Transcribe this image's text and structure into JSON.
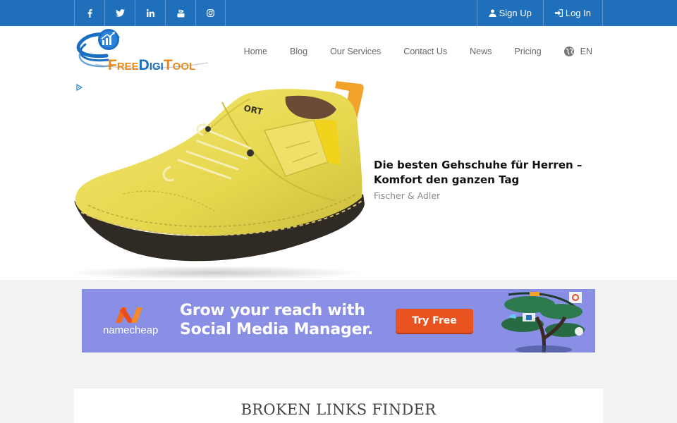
{
  "social": {
    "items": [
      {
        "icon": "facebook-icon",
        "glyph": "f"
      },
      {
        "icon": "twitter-icon",
        "glyph": ""
      },
      {
        "icon": "linkedin-icon",
        "glyph": "in"
      },
      {
        "icon": "youtube-icon",
        "glyph": ""
      },
      {
        "icon": "instagram-icon",
        "glyph": ""
      }
    ]
  },
  "auth": {
    "sign_up": "Sign Up",
    "log_in": "Log In"
  },
  "logo": {
    "part1": "Free",
    "part2": "Digi",
    "part3": "Tool"
  },
  "nav": {
    "items": [
      "Home",
      "Blog",
      "Our Services",
      "Contact Us",
      "News",
      "Pricing"
    ],
    "lang": "EN"
  },
  "ad": {
    "title": "Die besten Gehschuhe für Herren – Komfort den ganzen Tag",
    "source": "Fischer & Adler"
  },
  "banner": {
    "brand": "namecheap",
    "headline": "Grow your reach with Social Media Manager.",
    "cta": "Try Free"
  },
  "page": {
    "title": "BROKEN LINKS FINDER"
  },
  "colors": {
    "topbar": "#1f6fbb",
    "banner_bg": "#8a8fe6",
    "cta": "#e9531f",
    "logo_orange": "#e88a1a",
    "logo_blue": "#1a6fc4"
  }
}
